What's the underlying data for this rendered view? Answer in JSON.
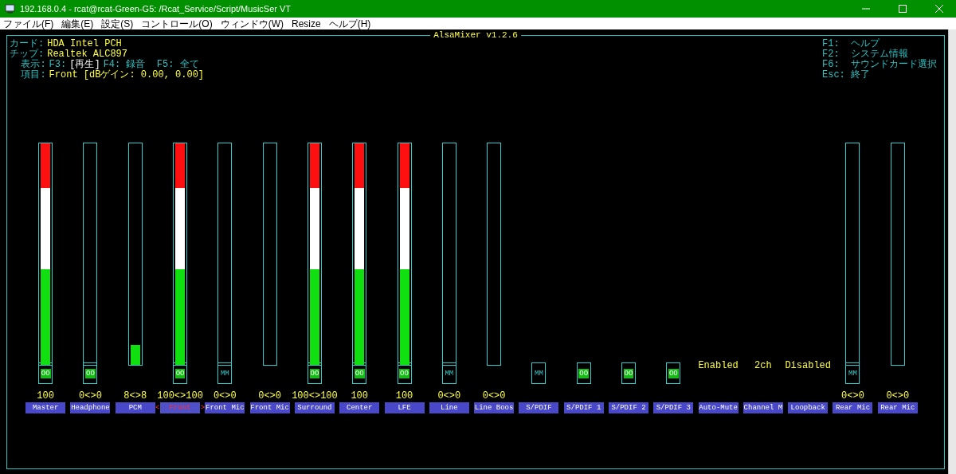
{
  "window": {
    "title": "192.168.0.4 - rcat@rcat-Green-G5: /Rcat_Service/Script/MusicSer VT"
  },
  "menu": [
    "ファイル(F)",
    "編集(E)",
    "設定(S)",
    "コントロール(O)",
    "ウィンドウ(W)",
    "Resize",
    "ヘルプ(H)"
  ],
  "mixer_title": "AlsaMixer v1.2.6",
  "info": [
    {
      "key": "カード:",
      "parts": [
        {
          "text": "HDA Intel PCH",
          "kind": "value"
        }
      ]
    },
    {
      "key": "チップ:",
      "parts": [
        {
          "text": "Realtek ALC897",
          "kind": "value"
        }
      ]
    },
    {
      "key": "  表示:",
      "parts": [
        {
          "text": "F3:",
          "kind": "key"
        },
        {
          "text": "[再生]",
          "kind": "active"
        },
        {
          "text": "F4: 録音  F5: 全て",
          "kind": "key"
        }
      ]
    },
    {
      "key": "  項目:",
      "parts": [
        {
          "text": "Front [dBゲイン: 0.00, 0.00]",
          "kind": "value"
        }
      ]
    }
  ],
  "help": [
    {
      "key": "F1:",
      "text": "ヘルプ"
    },
    {
      "key": "F2:",
      "text": "システム情報"
    },
    {
      "key": "F6:",
      "text": "サウンドカード選択"
    },
    {
      "key": "Esc:",
      "text": "終了"
    }
  ],
  "selection_marks": {
    "left": "<",
    "right": ">"
  },
  "channels": [
    {
      "name": "Master",
      "kind": "volume",
      "value": "100",
      "level": 1,
      "muted": false,
      "mute_text": "OO",
      "selected": false
    },
    {
      "name": "Headphone",
      "kind": "volume",
      "value": "0<>0",
      "level": 0,
      "muted": false,
      "mute_text": "OO",
      "selected": false
    },
    {
      "name": "PCM",
      "kind": "volume",
      "value": "8<>8",
      "level": 0.09,
      "selected": false
    },
    {
      "name": "Front",
      "kind": "volume",
      "value": "100<>100",
      "level": 1,
      "muted": false,
      "mute_text": "OO",
      "selected": true
    },
    {
      "name": "Front Mic",
      "kind": "volume",
      "value": "0<>0",
      "level": 0,
      "muted": true,
      "mute_text": "MM",
      "selected": false
    },
    {
      "name": "Front Mic",
      "kind": "volume",
      "value": "0<>0",
      "level": 0,
      "selected": false
    },
    {
      "name": "Surround",
      "kind": "volume",
      "value": "100<>100",
      "level": 1,
      "muted": false,
      "mute_text": "OO",
      "selected": false
    },
    {
      "name": "Center",
      "kind": "volume",
      "value": "100",
      "level": 1,
      "muted": false,
      "mute_text": "OO",
      "selected": false
    },
    {
      "name": "LFE",
      "kind": "volume",
      "value": "100",
      "level": 1,
      "muted": false,
      "mute_text": "OO",
      "selected": false
    },
    {
      "name": "Line",
      "kind": "volume",
      "value": "0<>0",
      "level": 0,
      "muted": true,
      "mute_text": "MM",
      "selected": false
    },
    {
      "name": "Line Boos",
      "kind": "volume",
      "value": "0<>0",
      "level": 0,
      "selected": false
    },
    {
      "name": "S/PDIF",
      "kind": "switch",
      "muted": true,
      "mute_text": "MM",
      "selected": false
    },
    {
      "name": "S/PDIF 1",
      "kind": "switch",
      "muted": false,
      "mute_text": "OO",
      "selected": false
    },
    {
      "name": "S/PDIF 2",
      "kind": "switch",
      "muted": false,
      "mute_text": "OO",
      "selected": false
    },
    {
      "name": "S/PDIF 3",
      "kind": "switch",
      "muted": false,
      "mute_text": "OO",
      "selected": false
    },
    {
      "name": "Auto-Mute",
      "kind": "enum",
      "value": "Enabled",
      "selected": false
    },
    {
      "name": "Channel M",
      "kind": "enum",
      "value": "2ch",
      "selected": false
    },
    {
      "name": "Loopback",
      "kind": "enum",
      "value": "Disabled",
      "selected": false
    },
    {
      "name": "Rear Mic",
      "kind": "volume",
      "value": "0<>0",
      "level": 0,
      "muted": true,
      "mute_text": "MM",
      "selected": false
    },
    {
      "name": "Rear Mic",
      "kind": "volume",
      "value": "0<>0",
      "level": 0,
      "selected": false
    }
  ]
}
